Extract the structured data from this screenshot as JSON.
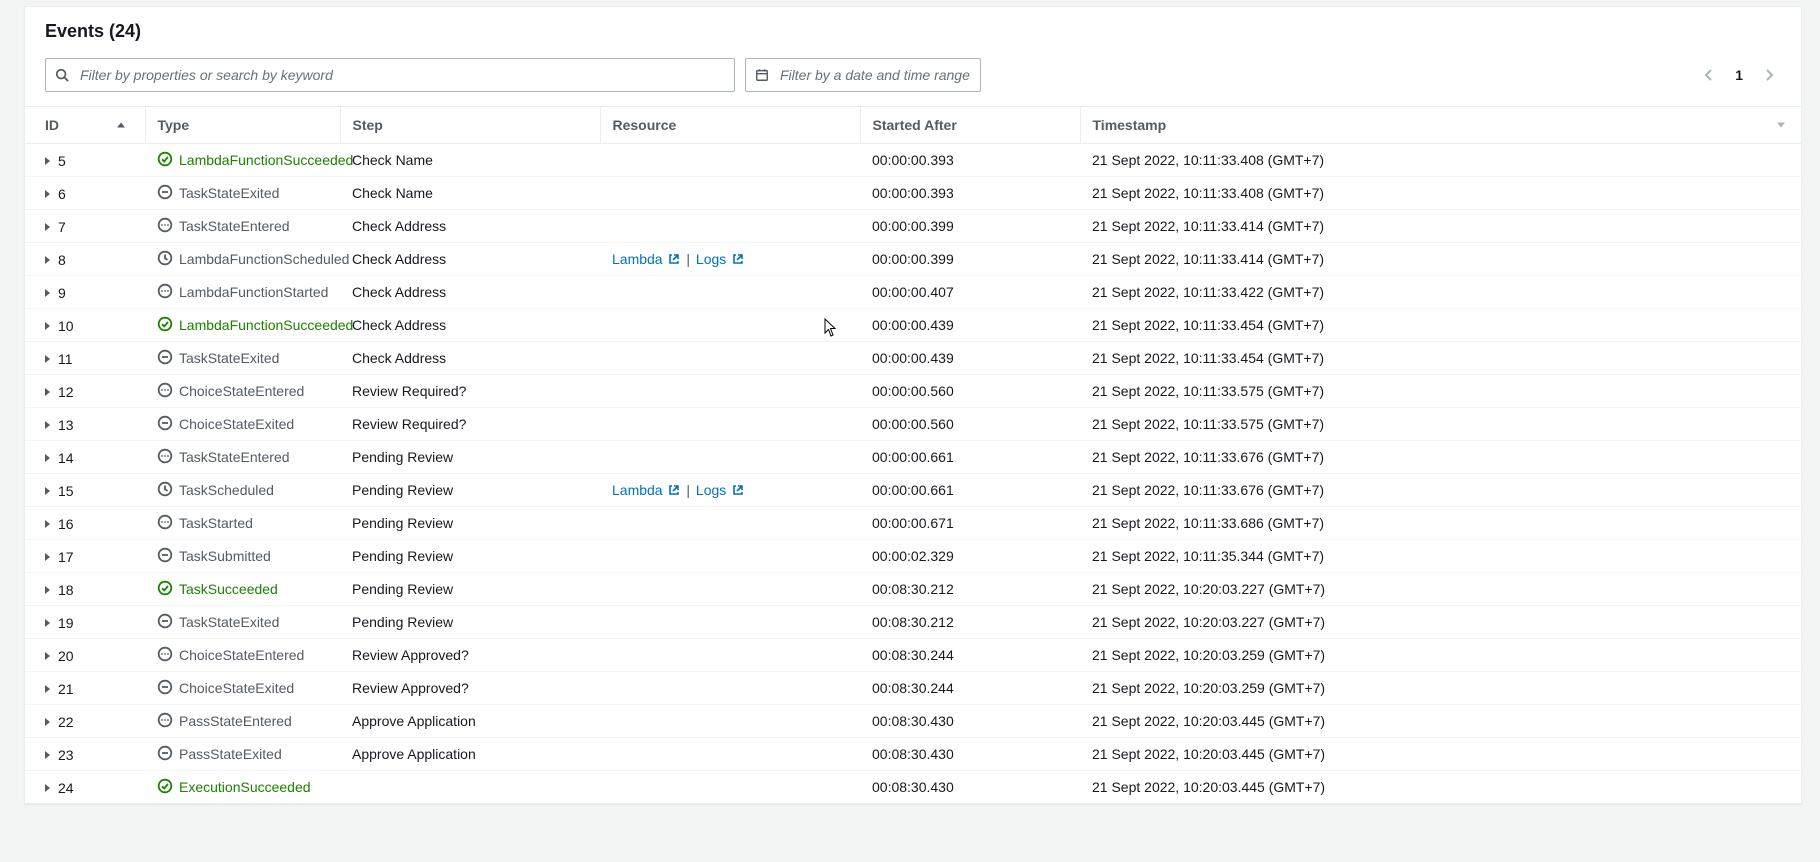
{
  "header": {
    "title": "Events (24)"
  },
  "filters": {
    "search_placeholder": "Filter by properties or search by keyword",
    "date_placeholder": "Filter by a date and time range"
  },
  "pagination": {
    "page": "1"
  },
  "columns": {
    "id": "ID",
    "type": "Type",
    "step": "Step",
    "resource": "Resource",
    "started_after": "Started After",
    "timestamp": "Timestamp"
  },
  "resource_links": {
    "lambda": "Lambda",
    "logs": "Logs",
    "sep": " | "
  },
  "rows": [
    {
      "id": "5",
      "type": "LambdaFunctionSucceeded",
      "status": "success",
      "icon": "check",
      "step": "Check Name",
      "resource": null,
      "started_after": "00:00:00.393",
      "timestamp": "21 Sept 2022, 10:11:33.408 (GMT+7)"
    },
    {
      "id": "6",
      "type": "TaskStateExited",
      "status": "neutral",
      "icon": "minus",
      "step": "Check Name",
      "resource": null,
      "started_after": "00:00:00.393",
      "timestamp": "21 Sept 2022, 10:11:33.408 (GMT+7)"
    },
    {
      "id": "7",
      "type": "TaskStateEntered",
      "status": "neutral",
      "icon": "dots",
      "step": "Check Address",
      "resource": null,
      "started_after": "00:00:00.399",
      "timestamp": "21 Sept 2022, 10:11:33.414 (GMT+7)"
    },
    {
      "id": "8",
      "type": "LambdaFunctionScheduled",
      "status": "neutral",
      "icon": "clock",
      "step": "Check Address",
      "resource": "lambda_logs",
      "started_after": "00:00:00.399",
      "timestamp": "21 Sept 2022, 10:11:33.414 (GMT+7)"
    },
    {
      "id": "9",
      "type": "LambdaFunctionStarted",
      "status": "neutral",
      "icon": "dots",
      "step": "Check Address",
      "resource": null,
      "started_after": "00:00:00.407",
      "timestamp": "21 Sept 2022, 10:11:33.422 (GMT+7)"
    },
    {
      "id": "10",
      "type": "LambdaFunctionSucceeded",
      "status": "success",
      "icon": "check",
      "step": "Check Address",
      "resource": null,
      "started_after": "00:00:00.439",
      "timestamp": "21 Sept 2022, 10:11:33.454 (GMT+7)"
    },
    {
      "id": "11",
      "type": "TaskStateExited",
      "status": "neutral",
      "icon": "minus",
      "step": "Check Address",
      "resource": null,
      "started_after": "00:00:00.439",
      "timestamp": "21 Sept 2022, 10:11:33.454 (GMT+7)"
    },
    {
      "id": "12",
      "type": "ChoiceStateEntered",
      "status": "neutral",
      "icon": "dots",
      "step": "Review Required?",
      "resource": null,
      "started_after": "00:00:00.560",
      "timestamp": "21 Sept 2022, 10:11:33.575 (GMT+7)"
    },
    {
      "id": "13",
      "type": "ChoiceStateExited",
      "status": "neutral",
      "icon": "minus",
      "step": "Review Required?",
      "resource": null,
      "started_after": "00:00:00.560",
      "timestamp": "21 Sept 2022, 10:11:33.575 (GMT+7)"
    },
    {
      "id": "14",
      "type": "TaskStateEntered",
      "status": "neutral",
      "icon": "dots",
      "step": "Pending Review",
      "resource": null,
      "started_after": "00:00:00.661",
      "timestamp": "21 Sept 2022, 10:11:33.676 (GMT+7)"
    },
    {
      "id": "15",
      "type": "TaskScheduled",
      "status": "neutral",
      "icon": "clock",
      "step": "Pending Review",
      "resource": "lambda_logs",
      "started_after": "00:00:00.661",
      "timestamp": "21 Sept 2022, 10:11:33.676 (GMT+7)"
    },
    {
      "id": "16",
      "type": "TaskStarted",
      "status": "neutral",
      "icon": "dots",
      "step": "Pending Review",
      "resource": null,
      "started_after": "00:00:00.671",
      "timestamp": "21 Sept 2022, 10:11:33.686 (GMT+7)"
    },
    {
      "id": "17",
      "type": "TaskSubmitted",
      "status": "neutral",
      "icon": "minus",
      "step": "Pending Review",
      "resource": null,
      "started_after": "00:00:02.329",
      "timestamp": "21 Sept 2022, 10:11:35.344 (GMT+7)"
    },
    {
      "id": "18",
      "type": "TaskSucceeded",
      "status": "success",
      "icon": "check",
      "step": "Pending Review",
      "resource": null,
      "started_after": "00:08:30.212",
      "timestamp": "21 Sept 2022, 10:20:03.227 (GMT+7)"
    },
    {
      "id": "19",
      "type": "TaskStateExited",
      "status": "neutral",
      "icon": "minus",
      "step": "Pending Review",
      "resource": null,
      "started_after": "00:08:30.212",
      "timestamp": "21 Sept 2022, 10:20:03.227 (GMT+7)"
    },
    {
      "id": "20",
      "type": "ChoiceStateEntered",
      "status": "neutral",
      "icon": "dots",
      "step": "Review Approved?",
      "resource": null,
      "started_after": "00:08:30.244",
      "timestamp": "21 Sept 2022, 10:20:03.259 (GMT+7)"
    },
    {
      "id": "21",
      "type": "ChoiceStateExited",
      "status": "neutral",
      "icon": "minus",
      "step": "Review Approved?",
      "resource": null,
      "started_after": "00:08:30.244",
      "timestamp": "21 Sept 2022, 10:20:03.259 (GMT+7)"
    },
    {
      "id": "22",
      "type": "PassStateEntered",
      "status": "neutral",
      "icon": "dots",
      "step": "Approve Application",
      "resource": null,
      "started_after": "00:08:30.430",
      "timestamp": "21 Sept 2022, 10:20:03.445 (GMT+7)"
    },
    {
      "id": "23",
      "type": "PassStateExited",
      "status": "neutral",
      "icon": "minus",
      "step": "Approve Application",
      "resource": null,
      "started_after": "00:08:30.430",
      "timestamp": "21 Sept 2022, 10:20:03.445 (GMT+7)"
    },
    {
      "id": "24",
      "type": "ExecutionSucceeded",
      "status": "success",
      "icon": "check",
      "step": "",
      "resource": null,
      "started_after": "00:08:30.430",
      "timestamp": "21 Sept 2022, 10:20:03.445 (GMT+7)"
    }
  ]
}
